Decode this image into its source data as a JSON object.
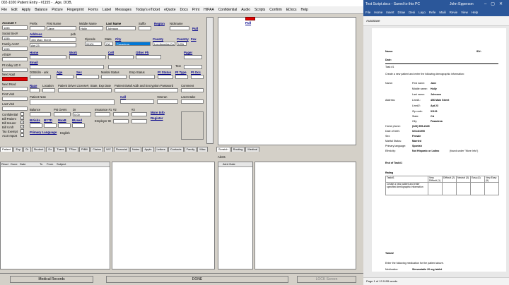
{
  "app": {
    "title": "002-1020 Patient Entry - #1155 - , Age, DOB,",
    "menu": [
      "File",
      "Edit",
      "Apply",
      "Balance",
      "Picture",
      "Fingerprint",
      "Forms",
      "Label",
      "Messages",
      "Today's eTicket",
      "eQuote",
      "Docs",
      "Print",
      "HIPAA",
      "Confidential",
      "Audio",
      "Scripts",
      "Confirm",
      "EDocs",
      "Help"
    ],
    "side": {
      "account_label": "Account #",
      "account": "1155",
      "ssn_label": "Social Sec#",
      "ssn": "1155",
      "family_label": "Family Acct#",
      "family": "1155",
      "all_label": "All ID#",
      "pt_today_label": "Pt today UD #",
      "next_appt": "Next Appt",
      "next_rsvd": "Next Rsvd",
      "first_visit": "First Visit",
      "last_visit": "Last Visit"
    },
    "fields": {
      "prefix_label": "Prefix",
      "first_label": "First Name",
      "first": "Jane",
      "middle_label": "Middle Name",
      "middle": "Holly",
      "last_label": "Last Name",
      "last": "Johnson",
      "suffix_label": "Suffix",
      "nickname_label": "Nickname",
      "address_label": "Address",
      "address1": "456 Main Street",
      "address2": "Apt 23",
      "pob_label": "pob",
      "zip_label": "Zipcode",
      "zip": "91101",
      "state_label": "State",
      "state": "CA",
      "city_label": "City",
      "city": "Pasadena",
      "county_label": "County",
      "county": "Los Angeles Co.",
      "country_label": "Country",
      "country": "USA",
      "region_label": "Region",
      "home_label": "Home",
      "work_label": "Work",
      "cell_label": "Cell",
      "other_label": "Other Ph",
      "pager_label": "Pager",
      "email_label": "Email",
      "fax_label": "Fax",
      "text_label": "Text",
      "dob_label": "DOB/dm - unk",
      "age_label": "Age",
      "sex_label": "Sex",
      "marital_label": "Marital Status",
      "emp_label": "Emp Status",
      "pt_status_label": "Pt Status",
      "pt_type_label": "Pt Type",
      "pt_occ_label": "Pt Occ",
      "race_label": "Race",
      "location_label": "Location",
      "dl_label": "Patient Driver License#, State, Exp Date",
      "ecomment_label": "Patient EMail Addr and Encryption Password",
      "comment_label": "Comment",
      "notes_label": "Patient Note",
      "call_label": "Call",
      "veteran_label": "Veteran",
      "lastvisit_label": "Last Intake",
      "balance_label": "Balance",
      "pastdue_label": "Pst Overs",
      "dr_label": "Dr",
      "ins1_label": "Insurance #1",
      "ins2_label": "#2",
      "ins3_label": "#3",
      "more_info": "More Info",
      "register": "Register",
      "recalls": "Recalls",
      "bvisits": "BVisits",
      "byt0": "BYTD",
      "maxb": "MaxB",
      "bused": "BUsed",
      "emp_id": "Employer ID",
      "primary_lang_label": "Primary Language",
      "primary_lang": "English",
      "confidential": "Confidential",
      "bill_patient": "Bill Patient",
      "bill_insurer": "Bill Insurer",
      "bill_vendor": "Bill V.mfr",
      "exempt": "Tax Exempt",
      "acct_import": "Acct Import",
      "no_photo": "No photo",
      "pull": "Pull",
      "pull2": "Pull",
      "dd_value": "0.00"
    },
    "tabs1": [
      "Patient",
      "Exp",
      "Dr",
      "Student",
      "Dx",
      "Trans",
      "TPlan",
      "PtBill",
      "Claims",
      "WC",
      "Financial",
      "Notes",
      "Appts",
      "Letters",
      "Contacts",
      "Family",
      "Misc"
    ],
    "tabs2": [
      "Scratch",
      "Routing",
      "Medical"
    ],
    "msg_cols": [
      "Read",
      "Done",
      "Date",
      "To",
      "From",
      "Subject"
    ],
    "alert_label": "Alerts",
    "alert_col": "Alert Date",
    "status": {
      "left": "Medical Records",
      "mid": "DONE",
      "right": "LOCK Screen"
    }
  },
  "word": {
    "title": "Test Script.docx - Saved to this PC",
    "user": "John Epperson",
    "tabs": [
      "File",
      "Home",
      "Insert",
      "Draw",
      "Desi",
      "Layo",
      "Refe",
      "Maili",
      "Revie",
      "View",
      "Help"
    ],
    "autosave": "AutoSave",
    "status": "Page 1 of 13   1155 words",
    "doc": {
      "name_label": "Name:",
      "id_label": "ID#:",
      "date_label": "Date:",
      "task1": "Task #1",
      "intro": "Create a new patient and enter the following demographic information:",
      "name": "Name:",
      "first_label": "First name:",
      "first": "Jane",
      "middle_label": "Middle name:",
      "middle": "Holly",
      "last_label": "Last name:",
      "last": "Johnson",
      "address": "Address:",
      "line1_label": "Line#1:",
      "line1": "456 Main Street",
      "line2_label": "Line#2:",
      "line2": "Apt 23",
      "zip_label": "Zip code:",
      "zip": "91101",
      "state_label": "State:",
      "state": "CA",
      "city_label": "City:",
      "city": "Pasadena",
      "phone_label": "Home phone:",
      "phone": "(323) 555-2345",
      "dob_label": "Date of birth:",
      "dob": "02/14/1990",
      "sex_label": "Sex:",
      "sex": "Female",
      "marital_label": "Marital Status:",
      "marital": "Married",
      "lang_label": "Primary language:",
      "lang": "Spanish",
      "eth_label": "Ethnicity:",
      "eth": "Not Hispanic or Latino",
      "eth_note": "(found under \"More Info\")",
      "end": "End of Task#1",
      "rating": "Rating",
      "task_col": "Task#1",
      "c1": "Very Difficult (1)",
      "c2": "Difficult (2)",
      "c3": "Neutral (3)",
      "c4": "Easy (4)",
      "c5": "Very Easy (5)",
      "row": "Create a new patient and enter specified demographic information",
      "task2": "Task#2",
      "task2_intro": "Enter the following medication for the patient above.",
      "med_label": "Medication:",
      "med": "Simvastatin 20 mg tablet"
    }
  }
}
